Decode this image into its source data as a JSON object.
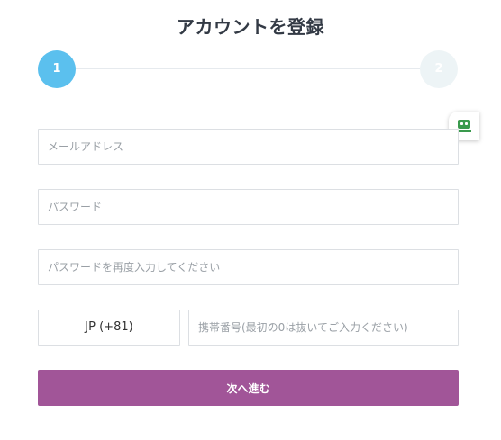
{
  "page": {
    "title": "アカウントを登録"
  },
  "stepper": {
    "step1": "1",
    "step2": "2"
  },
  "form": {
    "email_placeholder": "メールアドレス",
    "password_placeholder": "パスワード",
    "password_confirm_placeholder": "パスワードを再度入力してください",
    "country_code": "JP (+81)",
    "phone_placeholder": "携帯番号(最初の0は抜いてご入力ください)",
    "submit_label": "次へ進む"
  },
  "side_widget": {
    "icon": "robot-icon"
  },
  "colors": {
    "step_active": "#5bc0ee",
    "step_inactive": "#edf4f6",
    "submit": "#a15598",
    "widget_icon": "#3a9a4d"
  }
}
